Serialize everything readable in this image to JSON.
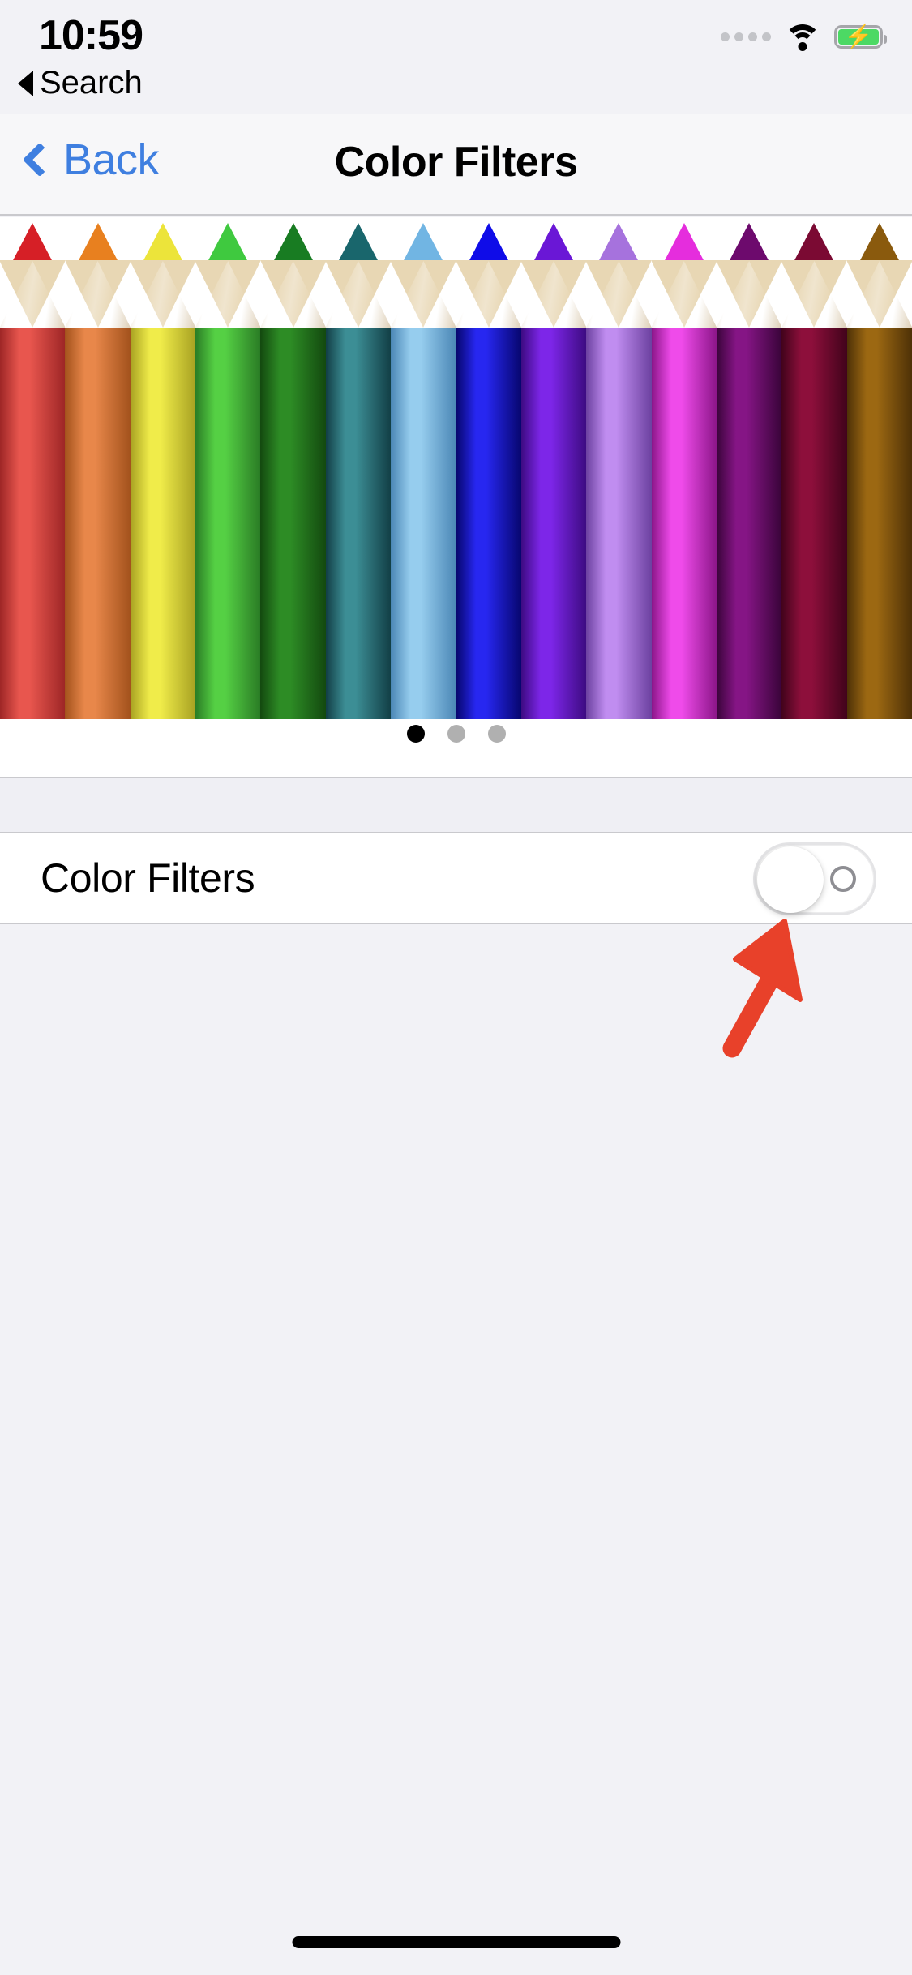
{
  "status_bar": {
    "time": "10:59",
    "cellular_icon": "cellular-dots-icon",
    "cellular_bars": 4,
    "wifi_icon": "wifi-icon",
    "battery_icon": "battery-charging-icon",
    "battery_charging": true,
    "battery_color": "#4cd964"
  },
  "return_to_app": {
    "icon": "back-triangle-icon",
    "label": "Search"
  },
  "nav_bar": {
    "back_icon": "chevron-left-icon",
    "back_label": "Back",
    "title": "Color Filters",
    "accent_color": "#3f7fe0"
  },
  "carousel": {
    "name": "color-pencils-preview",
    "pencil_count": 14,
    "pencils": [
      {
        "tip": "#d61f26",
        "barrel_mid": "#e8564e",
        "barrel_edge": "#9e2626"
      },
      {
        "tip": "#e8801f",
        "barrel_mid": "#e8874a",
        "barrel_edge": "#a3521c"
      },
      {
        "tip": "#ece43a",
        "barrel_mid": "#f0ec4a",
        "barrel_edge": "#a8a222"
      },
      {
        "tip": "#3fc93f",
        "barrel_mid": "#55d044",
        "barrel_edge": "#2a7c25"
      },
      {
        "tip": "#187c22",
        "barrel_mid": "#2d8c25",
        "barrel_edge": "#13490f"
      },
      {
        "tip": "#19666c",
        "barrel_mid": "#3c8e95",
        "barrel_edge": "#123f46"
      },
      {
        "tip": "#71b5e3",
        "barrel_mid": "#96cdee",
        "barrel_edge": "#4a86b5"
      },
      {
        "tip": "#0f0ce8",
        "barrel_mid": "#2727f0",
        "barrel_edge": "#07066e"
      },
      {
        "tip": "#6a17d6",
        "barrel_mid": "#7d26e8",
        "barrel_edge": "#3d0b82"
      },
      {
        "tip": "#a672dd",
        "barrel_mid": "#c08df0",
        "barrel_edge": "#6c41a0"
      },
      {
        "tip": "#e52ddd",
        "barrel_mid": "#ef4bea",
        "barrel_edge": "#8c1689"
      },
      {
        "tip": "#6d0a6d",
        "barrel_mid": "#851585",
        "barrel_edge": "#3a043a"
      },
      {
        "tip": "#7b0a33",
        "barrel_mid": "#8d0f3b",
        "barrel_edge": "#41031b"
      },
      {
        "tip": "#8a5a0d",
        "barrel_mid": "#9c6812",
        "barrel_edge": "#4e3107"
      }
    ],
    "wood_color": "#e8d7b4",
    "page_dots": {
      "total": 3,
      "active_index": 0,
      "active_color": "#000000",
      "inactive_color": "#b0b0b0"
    }
  },
  "settings": {
    "row_label": "Color Filters",
    "toggle_state": "off",
    "toggle_off_glyph": "circle-off-icon"
  },
  "annotation": {
    "arrow_name": "red-pointer-arrow",
    "arrow_color": "#e8412a",
    "points_to": "color-filters-toggle"
  },
  "home_indicator": {
    "name": "home-indicator",
    "color": "#000000"
  }
}
